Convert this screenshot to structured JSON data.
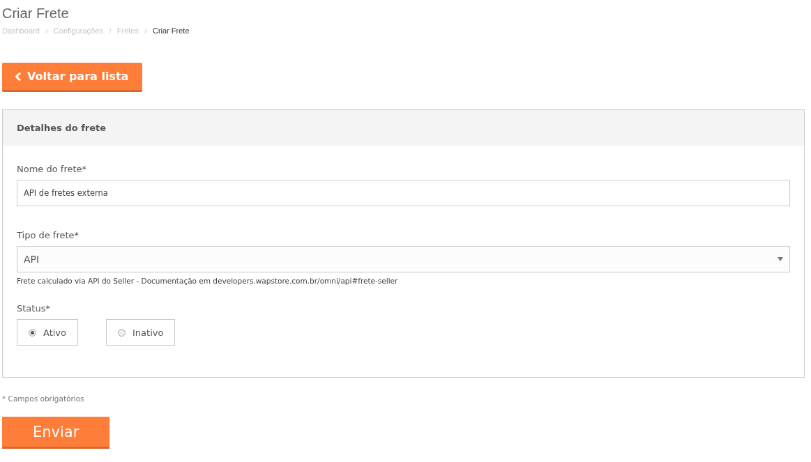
{
  "page_title": "Criar Frete",
  "breadcrumb": [
    {
      "label": "Dashboard",
      "current": false
    },
    {
      "label": "Configurações",
      "current": false
    },
    {
      "label": "Fretes",
      "current": false
    },
    {
      "label": "Criar Frete",
      "current": true
    }
  ],
  "back_button": {
    "label": "Voltar para lista"
  },
  "panel": {
    "title": "Detalhes do frete",
    "name_field": {
      "label": "Nome do frete*",
      "value": "API de fretes externa"
    },
    "type_field": {
      "label": "Tipo de frete*",
      "value": "API",
      "help": "Frete calculado via API do Seller - Documentação em developers.wapstore.com.br/omni/api#frete-seller"
    },
    "status": {
      "label": "Status*",
      "options": [
        {
          "label": "Ativo",
          "selected": true
        },
        {
          "label": "Inativo",
          "selected": false
        }
      ]
    }
  },
  "required_note": "* Campos obrigatórios",
  "submit_button": {
    "label": "Enviar"
  }
}
